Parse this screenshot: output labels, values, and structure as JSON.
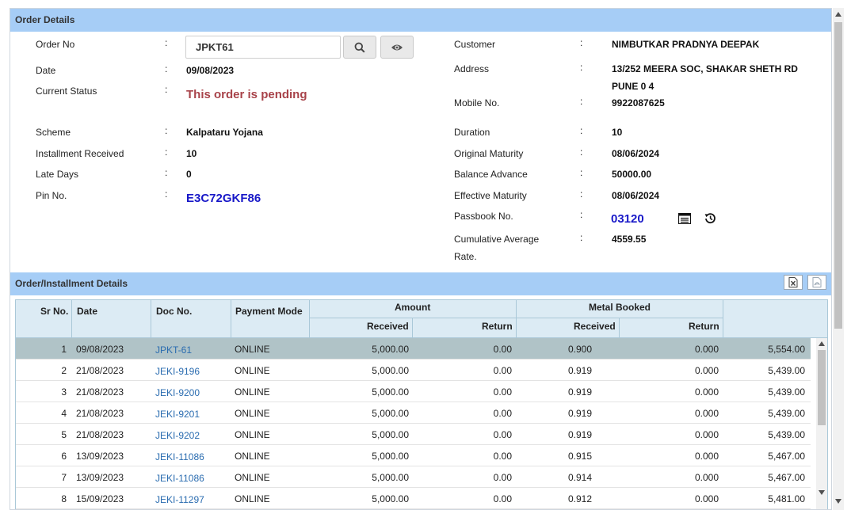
{
  "order_details": {
    "section_title": "Order Details",
    "order_no": {
      "label": "Order No",
      "value": "JPKT61"
    },
    "date": {
      "label": "Date",
      "value": "09/08/2023"
    },
    "current_status": {
      "label": "Current Status",
      "value": "This order is pending"
    },
    "scheme": {
      "label": "Scheme",
      "value": "Kalpataru Yojana"
    },
    "installment_received": {
      "label": "Installment Received",
      "value": "10"
    },
    "late_days": {
      "label": "Late Days",
      "value": "0"
    },
    "pin_no": {
      "label": "Pin No.",
      "value": "E3C72GKF86"
    },
    "customer": {
      "label": "Customer",
      "value": "NIMBUTKAR PRADNYA DEEPAK"
    },
    "address": {
      "label": "Address",
      "line1": "13/252 MEERA SOC, SHAKAR SHETH RD",
      "line2": "PUNE 0 4"
    },
    "mobile_no": {
      "label": "Mobile No.",
      "value": "9922087625"
    },
    "duration": {
      "label": "Duration",
      "value": "10"
    },
    "original_maturity": {
      "label": "Original Maturity",
      "value": "08/06/2024"
    },
    "balance_advance": {
      "label": "Balance Advance",
      "value": "50000.00"
    },
    "effective_maturity": {
      "label": "Effective Maturity",
      "value": "08/06/2024"
    },
    "passbook_no": {
      "label": "Passbook No.",
      "value": "03120"
    },
    "cumulative_rate": {
      "label_line1": "Cumulative Average",
      "label_line2": "Rate.",
      "value": "4559.55"
    },
    "colon": ":"
  },
  "installments": {
    "section_title": "Order/Installment Details",
    "headers": {
      "sr_no": "Sr No.",
      "date": "Date",
      "doc_no": "Doc No.",
      "payment_mode": "Payment Mode",
      "amount": "Amount",
      "amount_received": "Received",
      "amount_return": "Return",
      "metal_booked": "Metal Booked",
      "metal_received": "Received",
      "metal_return": "Return"
    },
    "rows": [
      {
        "sr": "1",
        "date": "09/08/2023",
        "doc": "JPKT-61",
        "mode": "ONLINE",
        "amt_recv": "5,000.00",
        "amt_ret": "0.00",
        "metal_recv": "0.900",
        "metal_ret": "0.000",
        "rate": "5,554.00"
      },
      {
        "sr": "2",
        "date": "21/08/2023",
        "doc": "JEKI-9196",
        "mode": "ONLINE",
        "amt_recv": "5,000.00",
        "amt_ret": "0.00",
        "metal_recv": "0.919",
        "metal_ret": "0.000",
        "rate": "5,439.00"
      },
      {
        "sr": "3",
        "date": "21/08/2023",
        "doc": "JEKI-9200",
        "mode": "ONLINE",
        "amt_recv": "5,000.00",
        "amt_ret": "0.00",
        "metal_recv": "0.919",
        "metal_ret": "0.000",
        "rate": "5,439.00"
      },
      {
        "sr": "4",
        "date": "21/08/2023",
        "doc": "JEKI-9201",
        "mode": "ONLINE",
        "amt_recv": "5,000.00",
        "amt_ret": "0.00",
        "metal_recv": "0.919",
        "metal_ret": "0.000",
        "rate": "5,439.00"
      },
      {
        "sr": "5",
        "date": "21/08/2023",
        "doc": "JEKI-9202",
        "mode": "ONLINE",
        "amt_recv": "5,000.00",
        "amt_ret": "0.00",
        "metal_recv": "0.919",
        "metal_ret": "0.000",
        "rate": "5,439.00"
      },
      {
        "sr": "6",
        "date": "13/09/2023",
        "doc": "JEKI-11086",
        "mode": "ONLINE",
        "amt_recv": "5,000.00",
        "amt_ret": "0.00",
        "metal_recv": "0.915",
        "metal_ret": "0.000",
        "rate": "5,467.00"
      },
      {
        "sr": "7",
        "date": "13/09/2023",
        "doc": "JEKI-11086",
        "mode": "ONLINE",
        "amt_recv": "5,000.00",
        "amt_ret": "0.00",
        "metal_recv": "0.914",
        "metal_ret": "0.000",
        "rate": "5,467.00"
      },
      {
        "sr": "8",
        "date": "15/09/2023",
        "doc": "JEKI-11297",
        "mode": "ONLINE",
        "amt_recv": "5,000.00",
        "amt_ret": "0.00",
        "metal_recv": "0.912",
        "metal_ret": "0.000",
        "rate": "5,481.00"
      }
    ]
  },
  "icons": {
    "search": "search-icon",
    "view": "eye-icon",
    "passbook_list": "list-icon",
    "history": "history-icon",
    "export_excel": "excel-icon",
    "export_pdf": "pdf-icon"
  },
  "colors": {
    "section_bar": "#a6cdf6",
    "pending_text": "#a8434a",
    "highlight_text": "#1818c8",
    "link_text": "#2a6cb0",
    "selected_row": "#b0c3c7",
    "grid_header": "#dcebf4"
  }
}
